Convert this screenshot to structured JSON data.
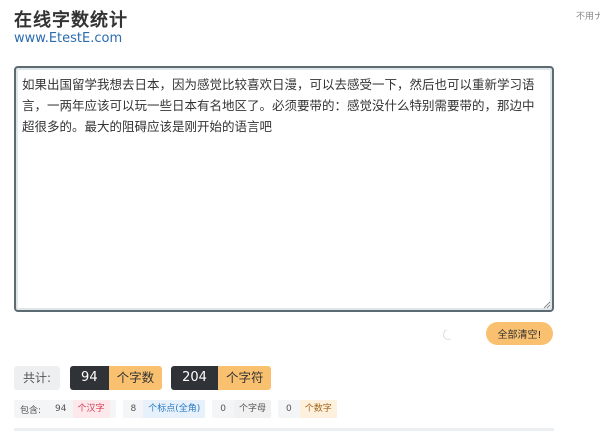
{
  "header": {
    "title": "在线字数统计",
    "site_link": "www.EtestE.com",
    "corner_text": "不用ナ"
  },
  "editor": {
    "value": "如果出国留学我想去日本，因为感觉比较喜欢日漫，可以去感受一下，然后也可以重新学习语言，一两年应该可以玩一些日本有名地区了。必须要带的：感觉没什么特别需要带的，那边中超很多的。最大的阻碍应该是刚开始的语言吧"
  },
  "actions": {
    "clear_label": "全部清空!"
  },
  "totals": {
    "label": "共计:",
    "chars_count": "94",
    "chars_unit": "个字数",
    "symbols_count": "204",
    "symbols_unit": "个字符"
  },
  "details": {
    "include_label": "包含:",
    "hanzi_count": "94",
    "hanzi_label": "个汉字",
    "punct_count": "8",
    "punct_label": "个标点(全角)",
    "letters_count": "0",
    "letters_label": "个字母",
    "digits_count": "0",
    "digits_label": "个数字"
  },
  "colors": {
    "accent": "#f9c16f",
    "dark_badge": "#2f3236",
    "hanzi_tag": "#d23b55",
    "punct_tag": "#2b7bc4",
    "digits_tag": "#a5651a"
  }
}
